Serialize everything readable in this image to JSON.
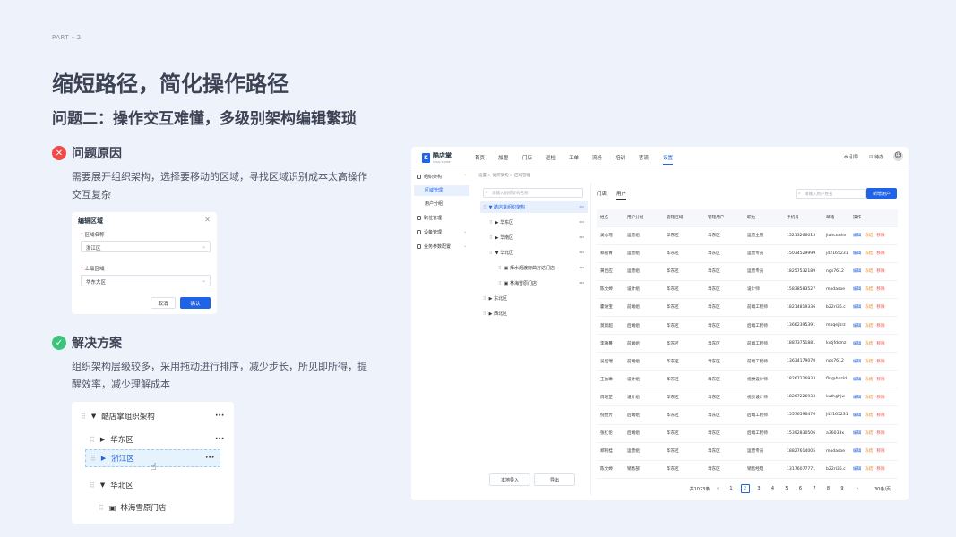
{
  "part": "PART - 2",
  "title": "缩短路径，简化操作路径",
  "subtitle": "问题二：操作交互难懂，多级别架构编辑繁琐",
  "problem": {
    "heading": "问题原因",
    "text": "需要展开组织架构，选择要移动的区域，寻找区域识别成本太高操作交互复杂"
  },
  "dialog": {
    "title": "编辑区域",
    "field1_label": "区域名称",
    "field1_value": "浙江区",
    "field2_label": "上级区域",
    "field2_value": "华东大区",
    "cancel": "取消",
    "confirm": "确认"
  },
  "solution": {
    "heading": "解决方案",
    "text": "组织架构层级较多，采用拖动进行排序，减少步长，所见即所得，提醒效率，减少理解成本"
  },
  "drag_tree": {
    "root": "酷店掌组织架构",
    "n1": "华东区",
    "n2": "浙江区",
    "n3": "华北区",
    "n4": "林海雪原门店"
  },
  "app": {
    "logo": "酷店掌",
    "logo_sub": "COOL STORE",
    "nav": [
      "首页",
      "加盟",
      "门店",
      "巡检",
      "工单",
      "流务",
      "培训",
      "客流",
      "设置"
    ],
    "guide": "引导",
    "todo": "待办",
    "side": {
      "org": "组织架构",
      "area": "区域管理",
      "users": "用户分组",
      "perm": "职位管理",
      "device": "设备管理",
      "biz": "业务参数配置"
    },
    "crumb": "设置 > 组织架构 > 区域管理",
    "tree_search": "请输入组织架构名称",
    "tree": [
      "酷店掌组织架构",
      "华东区",
      "华南区",
      "华北区",
      "拜水烟渡府曲万达门店",
      "林海雪原门店",
      "东北区",
      "西北区"
    ],
    "import": "本地导入",
    "export": "导出",
    "tabs": [
      "门店",
      "用户"
    ],
    "user_search": "请输入用户姓名",
    "add": "新增用户",
    "columns": [
      "姓名",
      "用户分组",
      "管辖区域",
      "管辖用户",
      "职位",
      "手机号",
      "邮箱",
      "操作"
    ],
    "rows": [
      [
        "吴心瑶",
        "运营组",
        "华东区",
        "华东区",
        "运营主管",
        "15213266013",
        "jiahcunhn"
      ],
      [
        "郑丽青",
        "运营组",
        "华东区",
        "华东区",
        "运营专员",
        "15034529999",
        "j42165231"
      ],
      [
        "黄昆应",
        "运营组",
        "华东区",
        "华东区",
        "运营专员",
        "18257532189",
        "ngs7612"
      ],
      [
        "陈文婷",
        "设计组",
        "华东区",
        "华东区",
        "设计师",
        "15838583527",
        "modasoe"
      ],
      [
        "霍进宝",
        "前端组",
        "华东区",
        "华东区",
        "前端工程师",
        "18214819336",
        "b22rl35.c"
      ],
      [
        "莫新超",
        "后端组",
        "华东区",
        "华东区",
        "后端工程师",
        "13662395391",
        "mbqejbrz"
      ],
      [
        "李雅蔓",
        "前端组",
        "华东区",
        "华东区",
        "前端工程师",
        "18873751881",
        "kvtjfdcmz"
      ],
      [
        "吴佳瑞",
        "前端组",
        "华东区",
        "华东区",
        "前端工程师",
        "13634179070",
        "ngs7612"
      ],
      [
        "王依琳",
        "设计组",
        "华东区",
        "华东区",
        "视觉设计师",
        "18267226933",
        "flrl@bozld"
      ],
      [
        "周晓芷",
        "设计组",
        "华东区",
        "华东区",
        "视觉设计师",
        "18267226933",
        "kuthghjw"
      ],
      [
        "倪悦芳",
        "后端组",
        "华东区",
        "华东区",
        "后端工程师",
        "15576596476",
        "j42165231"
      ],
      [
        "张红伦",
        "后端组",
        "华东区",
        "华东区",
        "后端工程师",
        "15392830506",
        "a36033x"
      ],
      [
        "郑铭桂",
        "运营组",
        "华东区",
        "华东区",
        "运营专员",
        "18827614005",
        "modasoe"
      ],
      [
        "陈文婷",
        "销售部",
        "华东区",
        "华东区",
        "销售经理",
        "13176077771",
        "b22rl35.c"
      ]
    ],
    "ops": [
      "编辑",
      "冻结",
      "移除"
    ],
    "total": "共1023条",
    "pages": [
      "1",
      "2",
      "3",
      "4",
      "5",
      "6",
      "7",
      "8",
      "9"
    ],
    "page_size": "30条/页"
  }
}
